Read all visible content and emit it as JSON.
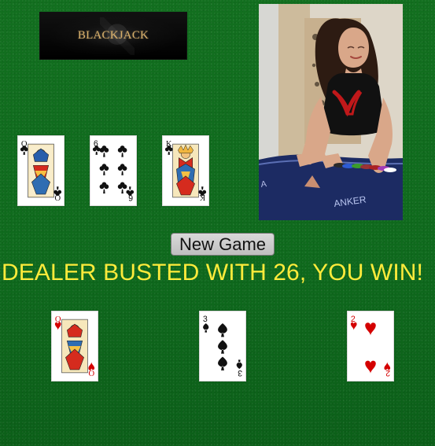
{
  "header": {
    "logo_text": "BLACKJACK"
  },
  "controls": {
    "new_game_label": "New Game"
  },
  "result": {
    "message": "DEALER BUSTED WITH 26, YOU WIN!"
  },
  "dealer_cards": [
    {
      "rank": "Q",
      "suit": "clubs"
    },
    {
      "rank": "6",
      "suit": "clubs"
    },
    {
      "rank": "K",
      "suit": "clubs"
    }
  ],
  "player_cards": [
    {
      "rank": "Q",
      "suit": "hearts"
    },
    {
      "rank": "3",
      "suit": "spades"
    },
    {
      "rank": "2",
      "suit": "hearts"
    }
  ],
  "colors": {
    "felt": "#0f6e1c",
    "message": "#ffeb3b",
    "button_bg": "#cfcfcf",
    "red_suit": "#d40000",
    "black_suit": "#111111"
  }
}
